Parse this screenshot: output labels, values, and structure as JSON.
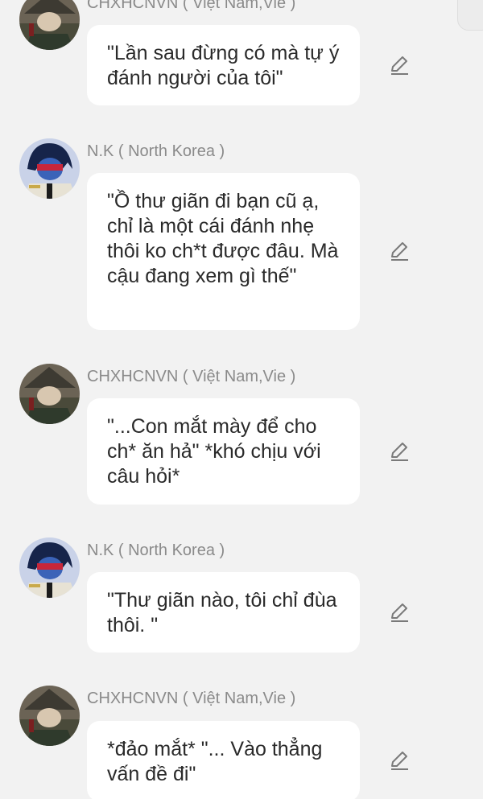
{
  "messages": [
    {
      "sender": "CHXHCNVN ( Việt Nam,Vie )",
      "avatar": "vietnam-avatar",
      "text": "\"Lần sau đừng có mà tự ý đánh người của tôi\""
    },
    {
      "sender": "N.K ( North Korea )",
      "avatar": "north-korea-avatar",
      "text": "\"Ồ thư giãn đi bạn cũ ạ, chỉ là một cái đánh nhẹ thôi ko ch*t được đâu. Mà cậu đang xem gì thế\""
    },
    {
      "sender": "CHXHCNVN ( Việt Nam,Vie )",
      "avatar": "vietnam-avatar",
      "text": "\"...Con mắt mày để cho ch* ăn hả\" *khó chịu với câu hỏi*"
    },
    {
      "sender": "N.K ( North Korea )",
      "avatar": "north-korea-avatar",
      "text": "\"Thư giãn nào, tôi chỉ đùa thôi. \""
    },
    {
      "sender": "CHXHCNVN ( Việt Nam,Vie )",
      "avatar": "vietnam-avatar",
      "text": "*đảo mắt* \"... Vào thẳng vấn đề đi\""
    }
  ],
  "icons": {
    "edit": "pencil-icon",
    "corner": "corner-button"
  },
  "colors": {
    "background": "#f2f2f2",
    "bubble": "#ffffff",
    "sender": "#8a8a8a",
    "text": "#2a2a2a"
  }
}
